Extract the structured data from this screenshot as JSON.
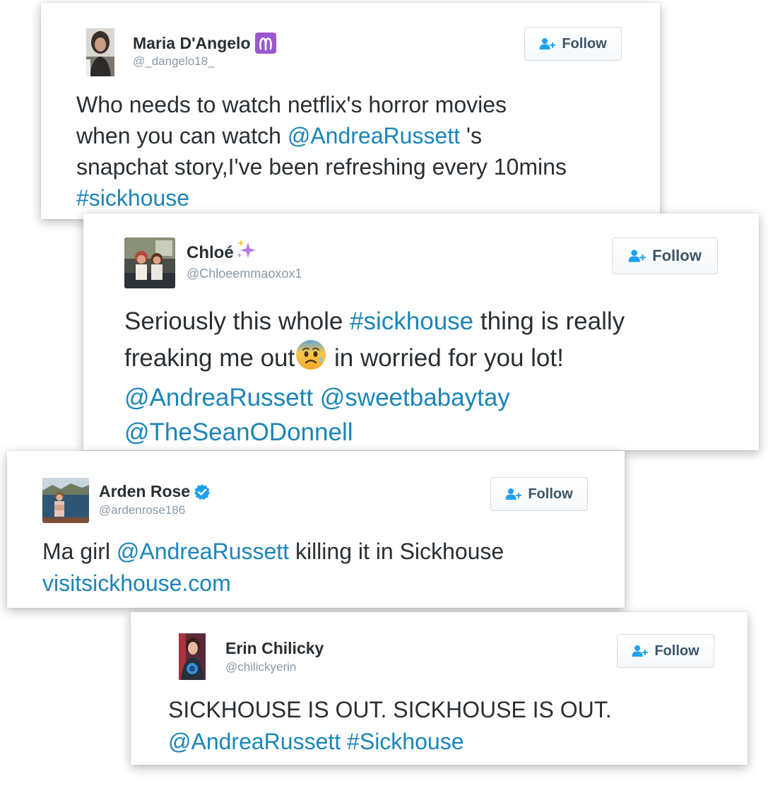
{
  "tweets": [
    {
      "name": "Maria D'Angelo",
      "badge_icon": "aries-emoji-icon",
      "handle": "@_dangelo18_",
      "follow_label": "Follow",
      "lines": [
        {
          "t1": "Who needs to watch netflix's horror movies"
        },
        {
          "t1": "when you can watch ",
          "m1": "@AndreaRussett",
          "t2": " 's"
        },
        {
          "t1": "snapchat story,I've been refreshing every 10mins"
        },
        {
          "h1": "#sickhouse"
        }
      ]
    },
    {
      "name": "Chloé",
      "badge_icon": "sparkles-emoji-icon",
      "handle": "@Chloeemmaoxox1",
      "follow_label": "Follow",
      "lines": [
        {
          "t1": "Seriously this whole ",
          "h1": "#sickhouse",
          "t2": " thing is really"
        },
        {
          "t1": "freaking me out",
          "emoji": "anxious-face-emoji-icon",
          "t2": " in worried for you lot!"
        },
        {
          "m1": "@AndreaRussett",
          "m2": "@sweetbabaytay"
        },
        {
          "m1": "@TheSeanODonnell"
        }
      ]
    },
    {
      "name": "Arden Rose",
      "badge_icon": "verified-badge-icon",
      "handle": "@ardenrose186",
      "follow_label": "Follow",
      "lines": [
        {
          "t1": "Ma girl ",
          "m1": "@AndreaRussett",
          "t2": " killing it in Sickhouse"
        },
        {
          "u1": "visitsickhouse.com"
        }
      ]
    },
    {
      "name": "Erin Chilicky",
      "handle": "@chilickyerin",
      "follow_label": "Follow",
      "lines": [
        {
          "t1": "SICKHOUSE IS OUT. SICKHOUSE IS OUT."
        },
        {
          "m1": "@AndreaRussett",
          "h1": "#Sickhouse"
        }
      ]
    }
  ],
  "colors": {
    "link": "#1b85b8",
    "text": "#292f33",
    "handle": "#8899a6",
    "follow_icon": "#1da1f2",
    "verified": "#1da1f2",
    "aries_badge": "#9b59d0"
  }
}
